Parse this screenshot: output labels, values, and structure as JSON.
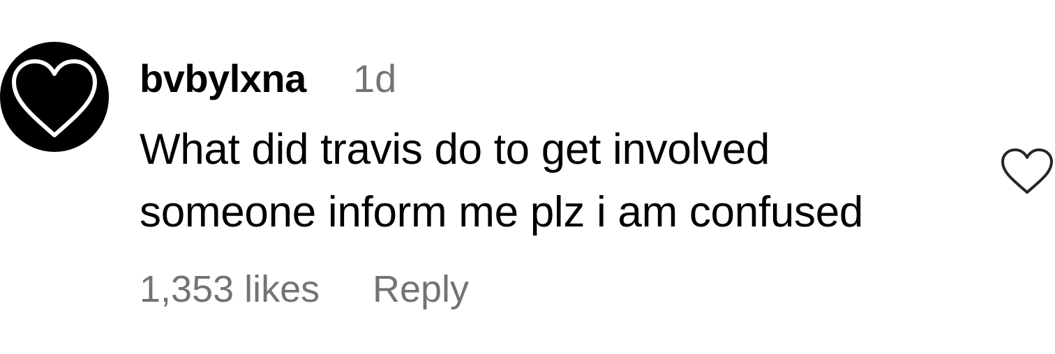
{
  "comment": {
    "username": "bvbylxna",
    "timestamp": "1d",
    "text_lines": [
      "What did travis do to get involved",
      "someone inform me plz i am confused"
    ],
    "likes_label": "1,353 likes",
    "reply_label": "Reply",
    "avatar_icon": "heart-outline-icon",
    "like_icon": "heart-outline-icon"
  },
  "colors": {
    "text_primary": "#000000",
    "text_secondary": "#737373",
    "avatar_background": "#000000",
    "avatar_heart_stroke": "#ffffff",
    "like_icon_stroke": "#262626",
    "background": "#ffffff"
  }
}
